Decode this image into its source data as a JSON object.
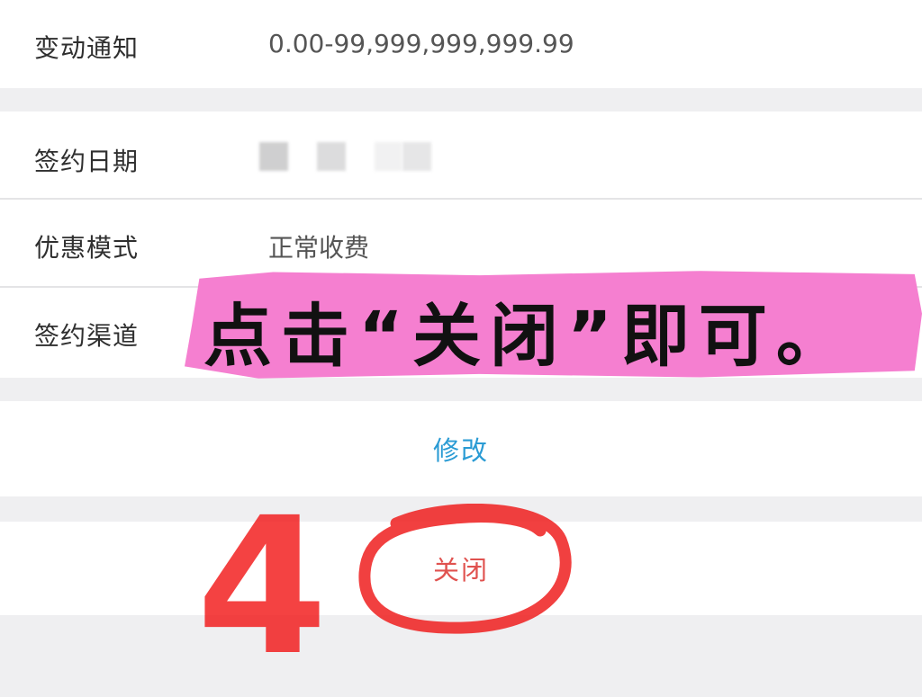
{
  "rows": {
    "change_notice": {
      "label": "变动通知",
      "value": "0.00-99,999,999,999.99"
    },
    "sign_date": {
      "label": "签约日期"
    },
    "discount_mode": {
      "label": "优惠模式",
      "value": "正常收费"
    },
    "sign_channel": {
      "label": "签约渠道"
    }
  },
  "actions": {
    "modify_label": "修改",
    "close_label": "关闭"
  },
  "annotation": {
    "instruction": "点击“关闭”即可。",
    "step_number": "4"
  },
  "colors": {
    "background": "#efeff1",
    "link_blue": "#2a9bd4",
    "close_red": "#e0524f",
    "highlight_pink": "#f57fd0",
    "annotation_red": "#f21818"
  }
}
